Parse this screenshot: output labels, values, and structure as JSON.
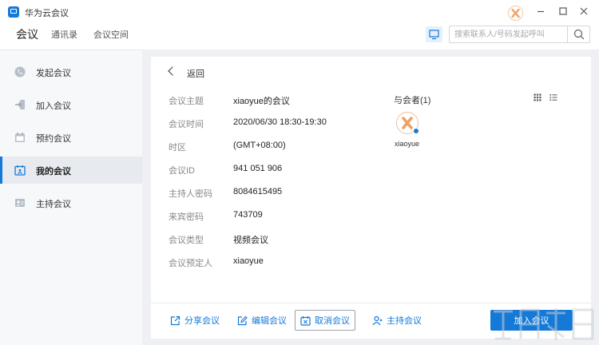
{
  "window": {
    "title": "华为云会议"
  },
  "nav": {
    "tabs": [
      {
        "label": "会议"
      },
      {
        "label": "通讯录"
      },
      {
        "label": "会议空间"
      }
    ]
  },
  "search": {
    "placeholder": "搜索联系人/号码发起呼叫"
  },
  "sidebar": {
    "items": [
      {
        "label": "发起会议",
        "icon": "phone-icon"
      },
      {
        "label": "加入会议",
        "icon": "join-icon"
      },
      {
        "label": "预约会议",
        "icon": "calendar-icon"
      },
      {
        "label": "我的会议",
        "icon": "my-meeting-icon",
        "active": true
      },
      {
        "label": "主持会议",
        "icon": "host-icon"
      }
    ]
  },
  "detail": {
    "back_label": "返回",
    "fields": [
      {
        "label": "会议主题",
        "value": "xiaoyue的会议"
      },
      {
        "label": "会议时间",
        "value": "2020/06/30 18:30-19:30"
      },
      {
        "label": "时区",
        "value": "(GMT+08:00)"
      },
      {
        "label": "会议ID",
        "value": "941 051 906"
      },
      {
        "label": "主持人密码",
        "value": "8084615495"
      },
      {
        "label": "来宾密码",
        "value": "743709"
      },
      {
        "label": "会议类型",
        "value": "视频会议"
      },
      {
        "label": "会议预定人",
        "value": "xiaoyue"
      }
    ],
    "participants": {
      "title": "与会者(1)",
      "list": [
        {
          "name": "xiaoyue"
        }
      ]
    }
  },
  "actions": {
    "share": "分享会议",
    "edit": "编辑会议",
    "cancel": "取消会议",
    "host": "主持会议",
    "join": "加入会议"
  },
  "colors": {
    "accent": "#1479d7",
    "avatar_orange": "#f0a061"
  }
}
